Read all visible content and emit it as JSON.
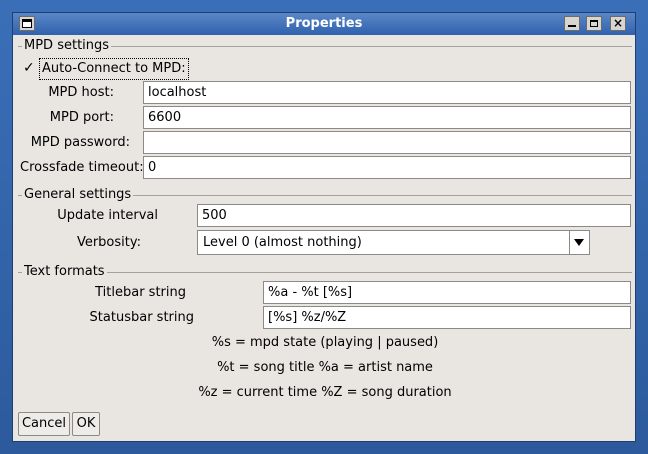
{
  "window": {
    "title": "Properties"
  },
  "mpd": {
    "section_title": "MPD settings",
    "auto_connect_label": "Auto-Connect to MPD:",
    "auto_connect_checked": true,
    "check_glyph": "✓",
    "host_label": "MPD host:",
    "host_value": "localhost",
    "port_label": "MPD port:",
    "port_value": "6600",
    "password_label": "MPD password:",
    "password_value": "",
    "crossfade_label": "Crossfade timeout:",
    "crossfade_value": "0"
  },
  "general": {
    "section_title": "General settings",
    "update_label": "Update interval",
    "update_value": "500",
    "verbosity_label": "Verbosity:",
    "verbosity_value": "Level 0 (almost nothing)"
  },
  "text_formats": {
    "section_title": "Text formats",
    "titlebar_label": "Titlebar string",
    "titlebar_value": "%a - %t [%s]",
    "statusbar_label": "Statusbar string",
    "statusbar_value": "[%s] %z/%Z",
    "help_1": "%s = mpd state (playing | paused)",
    "help_2": "%t = song title %a = artist name",
    "help_3": "%z = current time %Z = song duration"
  },
  "buttons": {
    "cancel": "Cancel",
    "ok": "OK"
  },
  "titlebar_controls": {
    "close_glyph": "×"
  }
}
